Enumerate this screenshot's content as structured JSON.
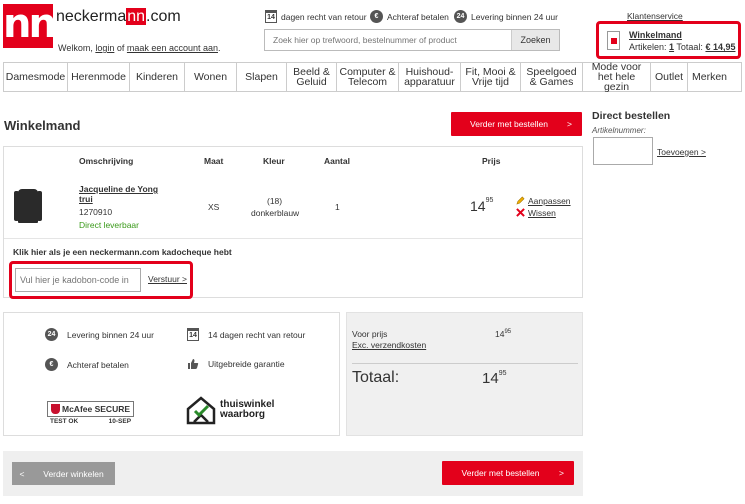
{
  "header": {
    "logo_text": "nn",
    "wordmark_pre": "neckerma",
    "wordmark_nn": "nn",
    "wordmark_post": ".com",
    "welcome_pre": "Welkom,",
    "login": "login",
    "welcome_mid": "of",
    "create_account": "maak een account aan",
    "welcome_end": ".",
    "usp_return_icon": "14",
    "usp_return": "dagen recht van retour",
    "usp_pay_icon": "€",
    "usp_pay": "Achteraf betalen",
    "usp_delivery_icon": "24",
    "usp_delivery": "Levering binnen 24 uur",
    "search_placeholder": "Zoek hier op trefwoord, bestelnummer of product",
    "search_button": "Zoeken",
    "customer_service": "Klantenservice",
    "cart_title": "Winkelmand",
    "cart_articles_label": "Artikelen:",
    "cart_articles_count": "1",
    "cart_total_label": "Totaal:",
    "cart_total": "€ 14,95"
  },
  "nav": [
    "Damesmode",
    "Herenmode",
    "Kinderen",
    "Wonen",
    "Slapen",
    "Beeld & Geluid",
    "Computer & Telecom",
    "Huishoud-apparatuur",
    "Fit, Mooi & Vrije tijd",
    "Speelgoed & Games",
    "Mode voor het hele gezin",
    "Outlet",
    "Merken"
  ],
  "page_title": "Winkelmand",
  "continue_button": "Verder met bestellen",
  "continue_arrow": ">",
  "table": {
    "headers": {
      "description": "Omschrijving",
      "size": "Maat",
      "color": "Kleur",
      "qty": "Aantal",
      "price": "Prijs"
    },
    "item": {
      "name_line1": "Jacqueline de Yong",
      "name_line2": "trui",
      "number": "1270910",
      "availability": "Direct leverbaar",
      "size": "XS",
      "color_code": "(18)",
      "color_name": "donkerblauw",
      "qty": "1",
      "price_int": "14",
      "price_dec": "95",
      "edit": "Aanpassen",
      "delete": "Wissen"
    }
  },
  "kado": {
    "text": "Klik hier als je een neckermann.com kadocheque hebt",
    "input_placeholder": "Vul hier je kadobon-code in",
    "send": "Verstuur >"
  },
  "usps": {
    "delivery_icon": "24",
    "delivery": "Levering binnen 24 uur",
    "return_icon": "14",
    "return": "14 dagen recht van retour",
    "pay_icon": "€",
    "pay": "Achteraf betalen",
    "warranty": "Uitgebreide garantie",
    "mcafee": "McAfee SECURE",
    "mcafee_test": "TEST OK",
    "mcafee_date": "10-SEP",
    "thuiswinkel_1": "thuiswinkel",
    "thuiswinkel_2": "waarborg"
  },
  "totals": {
    "voor_prijs_label": "Voor prijs",
    "voor_prijs_int": "14",
    "voor_prijs_dec": "95",
    "shipping_label": "Exc. verzendkosten",
    "total_label": "Totaal:",
    "total_int": "14",
    "total_dec": "95"
  },
  "bottom": {
    "back_arrow": "<",
    "back_label": "Verder winkelen",
    "continue_label": "Verder met bestellen",
    "continue_arrow": ">"
  },
  "direct": {
    "title": "Direct bestellen",
    "label": "Artikelnummer:",
    "add": "Toevoegen >"
  },
  "colors": {
    "brand_red": "#e3001b",
    "available_green": "#3a9a1a"
  }
}
